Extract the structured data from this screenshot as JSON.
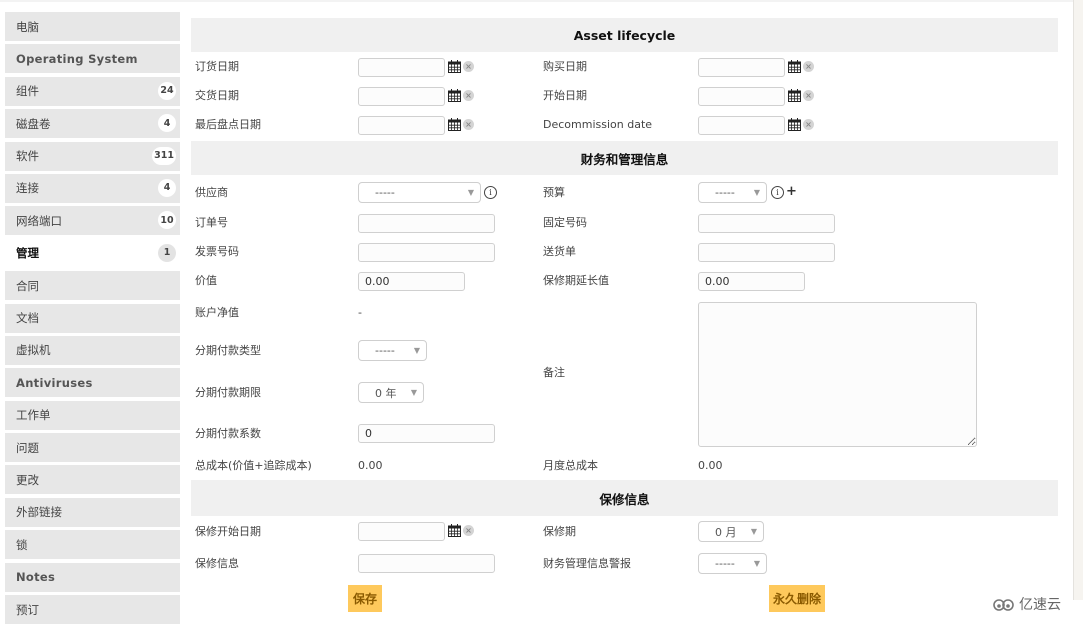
{
  "sidebar": {
    "items": [
      {
        "label": "电脑",
        "badge": null
      },
      {
        "label": "Operating System",
        "badge": null
      },
      {
        "label": "组件",
        "badge": "24"
      },
      {
        "label": "磁盘卷",
        "badge": "4"
      },
      {
        "label": "软件",
        "badge": "311"
      },
      {
        "label": "连接",
        "badge": "4"
      },
      {
        "label": "网络端口",
        "badge": "10"
      },
      {
        "label": "管理",
        "badge": "1"
      },
      {
        "label": "合同",
        "badge": null
      },
      {
        "label": "文档",
        "badge": null
      },
      {
        "label": "虚拟机",
        "badge": null
      },
      {
        "label": "Antiviruses",
        "badge": null
      },
      {
        "label": "工作单",
        "badge": null
      },
      {
        "label": "问题",
        "badge": null
      },
      {
        "label": "更改",
        "badge": null
      },
      {
        "label": "外部链接",
        "badge": null
      },
      {
        "label": "锁",
        "badge": null
      },
      {
        "label": "Notes",
        "badge": null
      },
      {
        "label": "预订",
        "badge": null
      }
    ],
    "active_index": 7
  },
  "lifecycle": {
    "title": "Asset lifecycle",
    "order_date_label": "订货日期",
    "purchase_date_label": "购买日期",
    "delivery_date_label": "交货日期",
    "start_date_label": "开始日期",
    "last_inventory_label": "最后盘点日期",
    "decommission_label": "Decommission date",
    "order_date": "",
    "purchase_date": "",
    "delivery_date": "",
    "start_date": "",
    "last_inventory_date": "",
    "decommission_date": ""
  },
  "finance": {
    "title": "财务和管理信息",
    "supplier_label": "供应商",
    "supplier_value": "-----",
    "budget_label": "预算",
    "budget_value": "-----",
    "order_number_label": "订单号",
    "order_number": "",
    "immo_number_label": "固定号码",
    "immo_number": "",
    "invoice_number_label": "发票号码",
    "invoice_number": "",
    "delivery_note_label": "送货单",
    "delivery_note": "",
    "value_label": "价值",
    "value": "0.00",
    "warranty_ext_label": "保修期延长值",
    "warranty_ext_value": "0.00",
    "net_value_label": "账户净值",
    "net_value": "-",
    "amort_type_label": "分期付款类型",
    "amort_type_value": "-----",
    "amort_period_label": "分期付款期限",
    "amort_period_value": "0 年",
    "amort_coeff_label": "分期付款系数",
    "amort_coeff_value": "0",
    "comment_label": "备注",
    "comment_value": "",
    "tco_label": "总成本(价值+追踪成本)",
    "tco_value": "0.00",
    "monthly_tco_label": "月度总成本",
    "monthly_tco_value": "0.00"
  },
  "warranty": {
    "title": "保修信息",
    "start_date_label": "保修开始日期",
    "start_date": "",
    "duration_label": "保修期",
    "duration_value": "0 月",
    "info_label": "保修信息",
    "info_value": "",
    "alert_label": "财务管理信息警报",
    "alert_value": "-----"
  },
  "actions": {
    "save_label": "保存",
    "purge_label": "永久删除"
  },
  "watermark": {
    "text": "亿速云"
  },
  "colors": {
    "button_bg": "#fec95c",
    "button_text": "#8a5a00",
    "section_bg": "#f0f0f0",
    "sidebar_bg": "#e7e7e7"
  }
}
